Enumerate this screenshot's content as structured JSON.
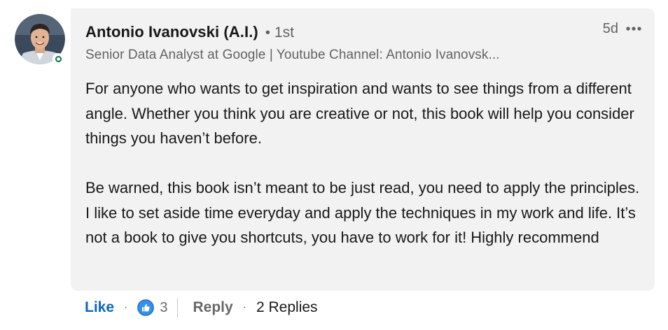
{
  "comment": {
    "author": {
      "name": "Antonio Ivanovski (A.I.)",
      "separator": "•",
      "degree": "1st",
      "headline": "Senior Data Analyst at Google | Youtube Channel: Antonio Ivanovsk...",
      "avatar_icon": "profile-photo",
      "presence_color": "#057642"
    },
    "timestamp": "5d",
    "more_icon": "ellipsis-icon",
    "paragraphs": [
      "For anyone who wants to get inspiration and wants to see things from a different angle. Whether you think you are creative or not, this book will help you consider things you haven’t before.",
      "Be warned, this book isn’t meant to be just read, you need to apply the principles. I like to set aside time everyday and apply the techniques in my work and life. It’s not a book to give you shortcuts, you have to work for it! Highly recommend"
    ],
    "bubble_color": "#f2f2f2"
  },
  "actions": {
    "like_label": "Like",
    "like_color": "#0a66c2",
    "separator": "·",
    "reaction_icon": "thumbs-up-reaction-icon",
    "reaction_count": "3",
    "reply_label": "Reply",
    "replies_label": "2 Replies"
  }
}
